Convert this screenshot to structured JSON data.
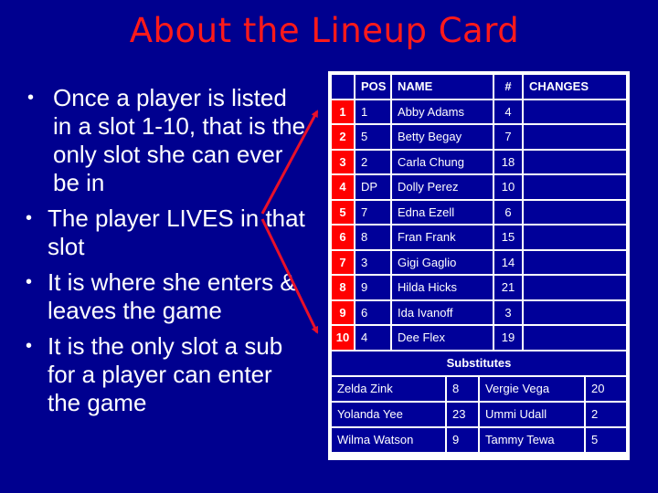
{
  "title": "About the Lineup Card",
  "bullets": [
    "Once a player is listed in a slot 1-10, that is the only slot she can ever be in",
    "The player LIVES in that slot",
    "It is where she enters & leaves the game",
    "It is the only slot a sub for a player can enter the game"
  ],
  "bullet_glyph": "•",
  "lineup": {
    "headers": {
      "slot": "",
      "pos": "POS",
      "name": "NAME",
      "number": "#",
      "changes": "CHANGES"
    },
    "rows": [
      {
        "slot": "1",
        "pos": "1",
        "name": "Abby Adams",
        "number": "4",
        "changes": ""
      },
      {
        "slot": "2",
        "pos": "5",
        "name": "Betty Begay",
        "number": "7",
        "changes": ""
      },
      {
        "slot": "3",
        "pos": "2",
        "name": "Carla Chung",
        "number": "18",
        "changes": ""
      },
      {
        "slot": "4",
        "pos": "DP",
        "name": "Dolly Perez",
        "number": "10",
        "changes": ""
      },
      {
        "slot": "5",
        "pos": "7",
        "name": "Edna Ezell",
        "number": "6",
        "changes": ""
      },
      {
        "slot": "6",
        "pos": "8",
        "name": "Fran Frank",
        "number": "15",
        "changes": ""
      },
      {
        "slot": "7",
        "pos": "3",
        "name": "Gigi Gaglio",
        "number": "14",
        "changes": ""
      },
      {
        "slot": "8",
        "pos": "9",
        "name": "Hilda Hicks",
        "number": "21",
        "changes": ""
      },
      {
        "slot": "9",
        "pos": "6",
        "name": "Ida Ivanoff",
        "number": "3",
        "changes": ""
      },
      {
        "slot": "10",
        "pos": "4",
        "name": "Dee Flex",
        "number": "19",
        "changes": ""
      }
    ]
  },
  "substitutes": {
    "heading": "Substitutes",
    "rows": [
      {
        "name1": "Zelda Zink",
        "num1": "8",
        "name2": "Vergie Vega",
        "num2": "20"
      },
      {
        "name1": "Yolanda Yee",
        "num1": "23",
        "name2": "Ummi Udall",
        "num2": "2"
      },
      {
        "name1": "Wilma Watson",
        "num1": "9",
        "name2": "Tammy Tewa",
        "num2": "5"
      }
    ]
  },
  "colors": {
    "background": "#00008f",
    "title": "#ff1a1a",
    "slot_cell": "#ff0000",
    "table_cell": "#000099",
    "arrow": "#e8102a"
  }
}
